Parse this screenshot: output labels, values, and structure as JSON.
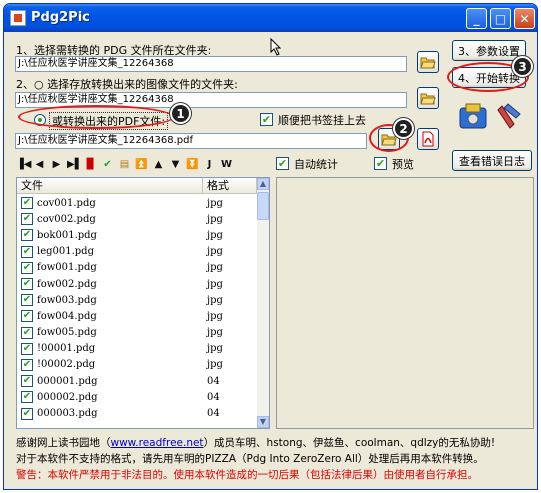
{
  "window": {
    "title": "Pdg2Pic",
    "controls": {
      "minimize": "_",
      "maximize": "□",
      "close": "✕"
    }
  },
  "step1": {
    "label": "1、选择需转换的 PDG 文件所在文件夹:",
    "path": "J:\\任应秋医学讲座文集_12264368"
  },
  "step2": {
    "label": "2、○ 选择存放转换出来的图像文件的文件夹:",
    "path": "J:\\任应秋医学讲座文集_12264368"
  },
  "pdf_option": {
    "label": "或转换出来的PDF文件:",
    "path": "J:\\任应秋医学讲座文集_12264368.pdf",
    "bookmark_label": "顺便把书签挂上去"
  },
  "buttons": {
    "params": "3、参数设置",
    "start": "4、开始转换",
    "error_log": "查看错误日志"
  },
  "options": {
    "auto_stats": "自动统计",
    "preview": "预览"
  },
  "toolbar": {
    "icons": [
      "▐◀",
      "◀",
      "▶",
      "▶▌",
      "pdf-icon",
      "✔",
      "list-icon",
      "⏫",
      "▲",
      "▼",
      "⏬",
      "J",
      "W"
    ]
  },
  "table": {
    "headers": [
      "文件",
      "格式"
    ],
    "rows": [
      {
        "name": "cov001.pdg",
        "format": "jpg"
      },
      {
        "name": "cov002.pdg",
        "format": "jpg"
      },
      {
        "name": "bok001.pdg",
        "format": "jpg"
      },
      {
        "name": "leg001.pdg",
        "format": "jpg"
      },
      {
        "name": "fow001.pdg",
        "format": "jpg"
      },
      {
        "name": "fow002.pdg",
        "format": "jpg"
      },
      {
        "name": "fow003.pdg",
        "format": "jpg"
      },
      {
        "name": "fow004.pdg",
        "format": "jpg"
      },
      {
        "name": "fow005.pdg",
        "format": "jpg"
      },
      {
        "name": "!00001.pdg",
        "format": "jpg"
      },
      {
        "name": "!00002.pdg",
        "format": "jpg"
      },
      {
        "name": "000001.pdg",
        "format": "04"
      },
      {
        "name": "000002.pdg",
        "format": "04"
      },
      {
        "name": "000003.pdg",
        "format": "04"
      }
    ]
  },
  "annotations": [
    "1",
    "2",
    "3"
  ],
  "footer": {
    "line1_a": "感谢网上读书园地（",
    "line1_link": "www.readfree.net",
    "line1_b": "）成员车明、hstong、伊兹鱼、coolman、qdlzy的无私协助!",
    "line2": "对于本软件不支持的格式，请先用车明的PIZZA（Pdg Into ZeroZero All）处理后再用本软件转换。",
    "line3": "警告：本软件严禁用于非法目的。使用本软件造成的一切后果（包括法律后果）由使用者自行承担。"
  },
  "colors": {
    "accent_red": "#e31a1a",
    "titlebar_blue": "#0054e3",
    "window_bg": "#ece9d8"
  }
}
